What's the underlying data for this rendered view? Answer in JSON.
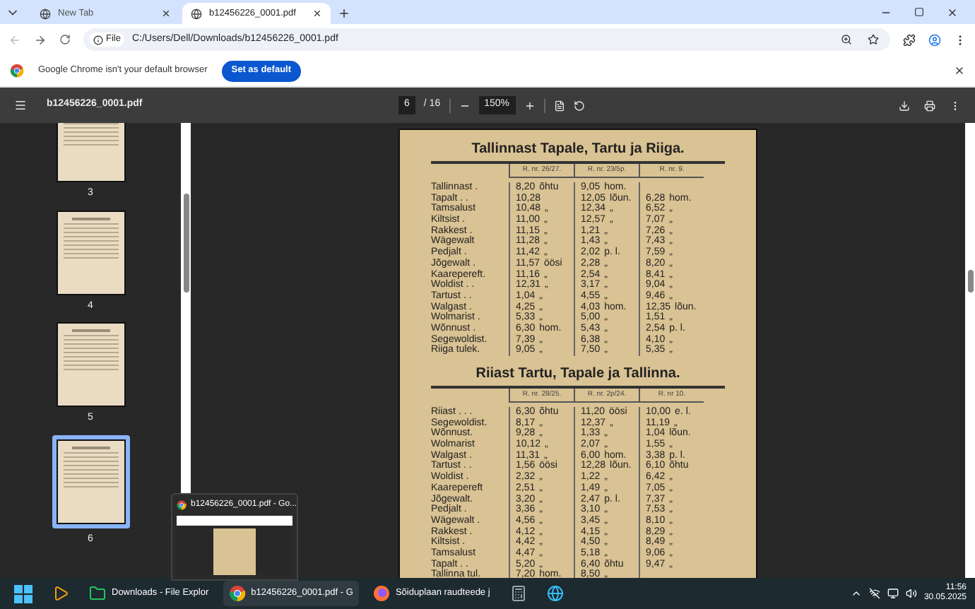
{
  "tabs": [
    {
      "title": "New Tab",
      "selected": false
    },
    {
      "title": "b12456226_0001.pdf",
      "selected": true
    }
  ],
  "address_bar": {
    "chip": "File",
    "url": "C:/Users/Dell/Downloads/b12456226_0001.pdf"
  },
  "infobar": {
    "message": "Google Chrome isn't your default browser",
    "button": "Set as default"
  },
  "pdf_toolbar": {
    "filename": "b12456226_0001.pdf",
    "page": "6",
    "page_total": "/ 16",
    "zoom": "150%"
  },
  "thumbnails": [
    {
      "label": "3",
      "selected": false
    },
    {
      "label": "4",
      "selected": false
    },
    {
      "label": "5",
      "selected": false
    },
    {
      "label": "6",
      "selected": true
    }
  ],
  "document": {
    "tables": [
      {
        "title": "Tallinnast Tapale, Tartu ja Riiga.",
        "columns": [
          "R. nr. 26/27.",
          "R. nr. 23/5p.",
          "R. nr. 9."
        ],
        "rows": [
          {
            "station": "Tallinnast .",
            "cells": [
              {
                "time": "8,20",
                "note": "õhtu"
              },
              {
                "time": "9,05",
                "note": "hom."
              },
              {}
            ]
          },
          {
            "station": "Tapalt . .",
            "cells": [
              {
                "time": "10,28"
              },
              {
                "time": "12,05",
                "note": "lõun."
              },
              {
                "time": "6,28",
                "note": "hom."
              }
            ]
          },
          {
            "station": "Tamsalust",
            "cells": [
              {
                "time": "10,48",
                "note": "„"
              },
              {
                "time": "12,34",
                "note": "„"
              },
              {
                "time": "6,52",
                "note": "„"
              }
            ]
          },
          {
            "station": "Kiltsist .",
            "cells": [
              {
                "time": "11,00",
                "note": "„"
              },
              {
                "time": "12,57",
                "note": "„"
              },
              {
                "time": "7,07",
                "note": "„"
              }
            ]
          },
          {
            "station": "Rakkest .",
            "cells": [
              {
                "time": "11,15",
                "note": "„"
              },
              {
                "time": "1,21",
                "note": "„"
              },
              {
                "time": "7,26",
                "note": "„"
              }
            ]
          },
          {
            "station": "Wägewalt",
            "cells": [
              {
                "time": "11,28",
                "note": "„"
              },
              {
                "time": "1,43",
                "note": "„"
              },
              {
                "time": "7,43",
                "note": "„"
              }
            ]
          },
          {
            "station": "Pedjalt .",
            "cells": [
              {
                "time": "11,42",
                "note": "„"
              },
              {
                "time": "2,02",
                "note": "p. l."
              },
              {
                "time": "7,59",
                "note": "„"
              }
            ]
          },
          {
            "station": "Jõgewalt .",
            "cells": [
              {
                "time": "11,57",
                "note": "öösi"
              },
              {
                "time": "2,28",
                "note": "„"
              },
              {
                "time": "8,20",
                "note": "„"
              }
            ]
          },
          {
            "station": "Kaarepereft.",
            "cells": [
              {
                "time": "11,16",
                "note": "„"
              },
              {
                "time": "2,54",
                "note": "„"
              },
              {
                "time": "8,41",
                "note": "„"
              }
            ]
          },
          {
            "station": "Woldist . .",
            "cells": [
              {
                "time": "12,31",
                "note": "„"
              },
              {
                "time": "3,17",
                "note": "„"
              },
              {
                "time": "9,04",
                "note": "„"
              }
            ]
          },
          {
            "station": "Tartust . .",
            "cells": [
              {
                "time": "1,04",
                "note": "„"
              },
              {
                "time": "4,55",
                "note": "„"
              },
              {
                "time": "9,46",
                "note": "„"
              }
            ]
          },
          {
            "station": "Walgast .",
            "cells": [
              {
                "time": "4,25",
                "note": "„"
              },
              {
                "time": "4,03",
                "note": "hom."
              },
              {
                "time": "12,35",
                "note": "lõun."
              }
            ]
          },
          {
            "station": "Wolmarist .",
            "cells": [
              {
                "time": "5,33",
                "note": "„"
              },
              {
                "time": "5,00",
                "note": "„"
              },
              {
                "time": "1,51",
                "note": "„"
              }
            ]
          },
          {
            "station": "Wõnnust .",
            "cells": [
              {
                "time": "6,30",
                "note": "hom."
              },
              {
                "time": "5,43",
                "note": "„"
              },
              {
                "time": "2,54",
                "note": "p. l."
              }
            ]
          },
          {
            "station": "Segewoldist.",
            "cells": [
              {
                "time": "7,39",
                "note": "„"
              },
              {
                "time": "6,38",
                "note": "„"
              },
              {
                "time": "4,10",
                "note": "„"
              }
            ]
          },
          {
            "station": "Riiga tulek.",
            "cells": [
              {
                "time": "9,05",
                "note": "„"
              },
              {
                "time": "7,50",
                "note": "„"
              },
              {
                "time": "5,35",
                "note": "„"
              }
            ]
          }
        ]
      },
      {
        "title": "Riiast Tartu, Tapale ja Tallinna.",
        "columns": [
          "R. nr. 28/25.",
          "R. nr. 2p/24.",
          "R. nr 10."
        ],
        "rows": [
          {
            "station": "Riiast . . .",
            "cells": [
              {
                "time": "6,30",
                "note": "õhtu"
              },
              {
                "time": "11,20",
                "note": "öösi"
              },
              {
                "time": "10,00",
                "note": "e. l."
              }
            ]
          },
          {
            "station": "Segewoldist.",
            "cells": [
              {
                "time": "8,17",
                "note": "„"
              },
              {
                "time": "12,37",
                "note": "„"
              },
              {
                "time": "11,19",
                "note": "„"
              }
            ]
          },
          {
            "station": "Wõnnust.",
            "cells": [
              {
                "time": "9,28",
                "note": "„"
              },
              {
                "time": "1,33",
                "note": "„"
              },
              {
                "time": "1,04",
                "note": "lõun."
              }
            ]
          },
          {
            "station": "Wolmarist",
            "cells": [
              {
                "time": "10,12",
                "note": "„"
              },
              {
                "time": "2,07",
                "note": "„"
              },
              {
                "time": "1,55",
                "note": "„"
              }
            ]
          },
          {
            "station": "Walgast .",
            "cells": [
              {
                "time": "11,31",
                "note": "„"
              },
              {
                "time": "6,00",
                "note": "hom."
              },
              {
                "time": "3,38",
                "note": "p. l."
              }
            ]
          },
          {
            "station": "Tartust . .",
            "cells": [
              {
                "time": "1,56",
                "note": "öösi"
              },
              {
                "time": "12,28",
                "note": "lõun."
              },
              {
                "time": "6,10",
                "note": "õhtu"
              }
            ]
          },
          {
            "station": "Woldist .",
            "cells": [
              {
                "time": "2,32",
                "note": "„"
              },
              {
                "time": "1,22",
                "note": "„"
              },
              {
                "time": "6,42",
                "note": "„"
              }
            ]
          },
          {
            "station": "Kaarepereft",
            "cells": [
              {
                "time": "2,51",
                "note": "„"
              },
              {
                "time": "1,49",
                "note": "„"
              },
              {
                "time": "7,05",
                "note": "„"
              }
            ]
          },
          {
            "station": "Jõgewalt.",
            "cells": [
              {
                "time": "3,20",
                "note": "„"
              },
              {
                "time": "2,47",
                "note": "p. l."
              },
              {
                "time": "7,37",
                "note": "„"
              }
            ]
          },
          {
            "station": "Pedjalt .",
            "cells": [
              {
                "time": "3,36",
                "note": "„"
              },
              {
                "time": "3,10",
                "note": "„"
              },
              {
                "time": "7,53",
                "note": "„"
              }
            ]
          },
          {
            "station": "Wägewalt .",
            "cells": [
              {
                "time": "4,56",
                "note": "„"
              },
              {
                "time": "3,45",
                "note": "„"
              },
              {
                "time": "8,10",
                "note": "„"
              }
            ]
          },
          {
            "station": "Rakkest .",
            "cells": [
              {
                "time": "4,12",
                "note": "„"
              },
              {
                "time": "4,15",
                "note": "„"
              },
              {
                "time": "8,29",
                "note": "„"
              }
            ]
          },
          {
            "station": "Kiltsist .",
            "cells": [
              {
                "time": "4,42",
                "note": "„"
              },
              {
                "time": "4,50",
                "note": "„"
              },
              {
                "time": "8,49",
                "note": "„"
              }
            ]
          },
          {
            "station": "Tamsalust",
            "cells": [
              {
                "time": "4,47",
                "note": "„"
              },
              {
                "time": "5,18",
                "note": "„"
              },
              {
                "time": "9,06",
                "note": "„"
              }
            ]
          },
          {
            "station": "Tapalt . .",
            "cells": [
              {
                "time": "5,20",
                "note": "„"
              },
              {
                "time": "6,40",
                "note": "õhtu"
              },
              {
                "time": "9,47",
                "note": "„"
              }
            ]
          },
          {
            "station": "Tallinna tul.",
            "cells": [
              {
                "time": "7,20",
                "note": "hom."
              },
              {
                "time": "8,50",
                "note": "„"
              },
              {}
            ]
          }
        ]
      }
    ]
  },
  "taskbar": {
    "items": [
      {
        "kind": "start",
        "selected": false
      },
      {
        "kind": "media",
        "selected": false
      },
      {
        "kind": "explorer",
        "label": "Downloads - File Explor",
        "selected": false
      },
      {
        "kind": "chrome",
        "label": "b12456226_0001.pdf - G",
        "selected": true
      },
      {
        "kind": "firefox",
        "label": "Sõiduplaan raudteede j",
        "selected": false
      },
      {
        "kind": "calculator",
        "selected": false
      },
      {
        "kind": "globe",
        "selected": false
      }
    ],
    "time": "11:56",
    "date": "30.05.2025"
  },
  "taskbar_preview": {
    "title": "b12456226_0001.pdf - Go..."
  }
}
